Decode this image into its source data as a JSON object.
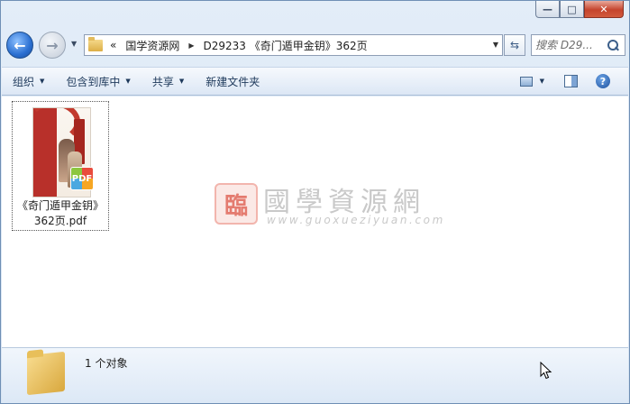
{
  "window": {
    "minimize_glyph": "—",
    "maximize_glyph": "□",
    "close_glyph": "✕"
  },
  "nav": {
    "back_glyph": "←",
    "forward_glyph": "→",
    "history_glyph": "▼",
    "overflow": "«",
    "breadcrumbs": [
      "国学资源网",
      "D29233 《奇门遁甲金钥》362页"
    ],
    "separator_glyph": "▶",
    "address_drop_glyph": "▼",
    "refresh_glyph": "⇆",
    "search_placeholder": "搜索 D29..."
  },
  "toolbar": {
    "organize": "组织",
    "include_library": "包含到库中",
    "share": "共享",
    "new_folder": "新建文件夹",
    "dropdown_glyph": "▼",
    "help_glyph": "?"
  },
  "files": [
    {
      "name_line1": "《奇门遁甲金钥》",
      "name_line2": "362页.pdf",
      "badge": "PDF"
    }
  ],
  "watermark": {
    "logo_char": "臨",
    "title": "國學資源網",
    "url": "www.guoxueziyuan.com"
  },
  "status": {
    "object_count": "1 个对象"
  },
  "colors": {
    "accent": "#2a6fd1",
    "close_red": "#c5442d",
    "toolbar_text": "#1e395b"
  }
}
